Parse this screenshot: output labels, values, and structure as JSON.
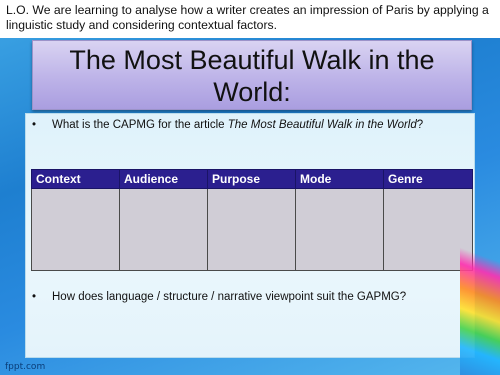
{
  "lo_banner": "L.O. We are learning to analyse how a writer creates an impression of Paris by applying a linguistic study and considering contextual factors.",
  "title": "The Most Beautiful Walk in the World:",
  "bullets": {
    "first_prefix": "What is the CAPMG for the article ",
    "first_italic": "The Most Beautiful Walk in the World",
    "first_suffix": "?",
    "second": "How does language / structure / narrative viewpoint suit the GAPMG?"
  },
  "table": {
    "headers": [
      "Context",
      "Audience",
      "Purpose",
      "Mode",
      "Genre"
    ]
  },
  "watermark": "fppt.com",
  "colors": {
    "header_bg": "#2b1f8f",
    "title_bg": "#bdb3e8",
    "cell_bg": "#d0cdd6"
  }
}
